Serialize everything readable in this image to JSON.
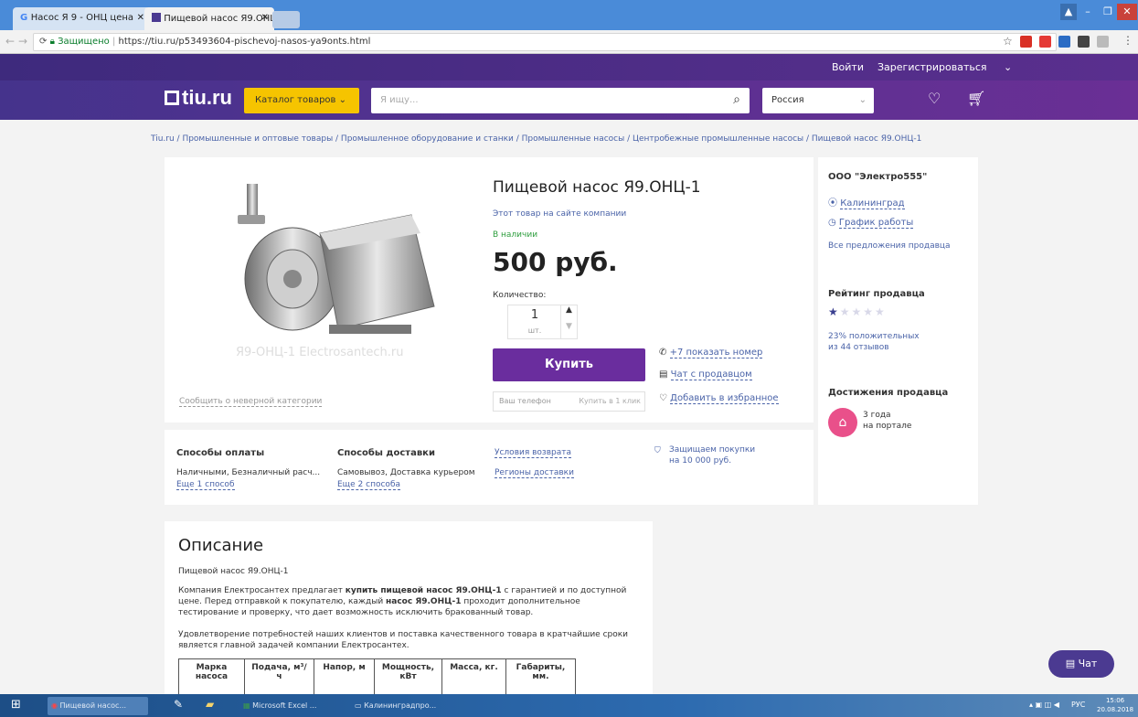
{
  "browser": {
    "tabs": [
      {
        "label": "Насос Я 9 - ОНЦ цена"
      },
      {
        "label": "Пищевой насос Я9.ОНЦ"
      }
    ],
    "secure_label": "Защищено",
    "url": "https://tiu.ru/p53493604-pischevoj-nasos-ya9onts.html"
  },
  "site": {
    "login": "Войти",
    "register": "Зарегистрироваться",
    "logo": "tiu.ru",
    "catalog": "Каталог товаров",
    "search_placeholder": "Я ищу...",
    "region": "Россия"
  },
  "breadcrumbs": "Tiu.ru / Промышленные и оптовые товары / Промышленное оборудование и станки / Промышленные насосы / Центробежные промышленные насосы / Пищевой насос Я9.ОНЦ-1",
  "product": {
    "title": "Пищевой насос Я9.ОНЦ-1",
    "company_link": "Этот товар на сайте компании",
    "availability": "В наличии",
    "price": "500 руб.",
    "qty_label": "Количество:",
    "qty_value": "1",
    "qty_unit": "шт.",
    "buy": "Купить",
    "show_phone": "+7 показать номер",
    "chat_seller": "Чат с продавцом",
    "add_fav": "Добавить в избранное",
    "phone_placeholder": "Ваш телефон",
    "one_click": "Купить в 1 клик",
    "report": "Сообщить о неверной категории",
    "watermark": "Я9-ОНЦ-1 Electrosantech.ru"
  },
  "seller": {
    "name": "ООО \"Электро555\"",
    "city": "Калининград",
    "schedule": "График работы",
    "all_offers": "Все предложения продавца",
    "rating_title": "Рейтинг продавца",
    "rating_text1": "23% положительных",
    "rating_text2": "из 44 отзывов",
    "achievements": "Достижения продавца",
    "years1": "3 года",
    "years2": "на портале"
  },
  "info": {
    "pay_title": "Способы оплаты",
    "pay_text": "Наличными, Безналичный расч...",
    "pay_more": "Еще 1 способ",
    "del_title": "Способы доставки",
    "del_text": "Самовывоз, Доставка курьером",
    "del_more": "Еще 2 способа",
    "return": "Условия возврата",
    "regions": "Регионы доставки",
    "protect1": "Защищаем покупки",
    "protect2": "на 10 000 руб."
  },
  "description": {
    "title": "Описание",
    "p1": "Пищевой насос Я9.ОНЦ-1",
    "p2a": "Компания Електросантех предлагает ",
    "p2b": "купить пищевой насос Я9.ОНЦ-1",
    "p2c": " с гарантией и по доступной цене. Перед отправкой к покупателю, каждый ",
    "p2d": "насос Я9.ОНЦ-1",
    "p2e": " проходит дополнительное тестирование и проверку, что дает возможность исключить бракованный товар.",
    "p3": "Удовлетворение потребностей наших клиентов и поставка качественного товара в кратчайшие сроки является главной задачей компании Електросантех.",
    "table_headers": [
      "Марка насоса",
      "Подача, м³/ч",
      "Напор, м",
      "Мощность, кВт",
      "Масса, кг.",
      "Габариты, мм."
    ]
  },
  "chat": "Чат",
  "taskbar": {
    "items": [
      "Пищевой насос...",
      "Microsoft Excel ...",
      "Калининградпро..."
    ],
    "lang": "РУС",
    "time": "15:06",
    "date": "20.08.2018"
  }
}
